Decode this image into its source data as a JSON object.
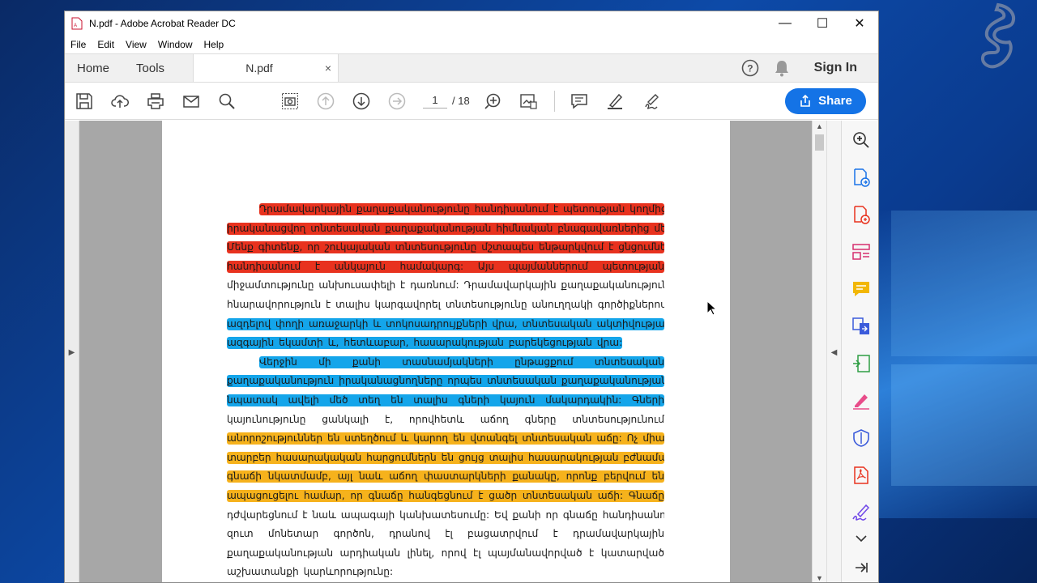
{
  "window": {
    "title": "N.pdf - Adobe Acrobat Reader DC",
    "controls": {
      "minimize": "—",
      "maximize": "☐",
      "close": "✕"
    }
  },
  "menu": [
    "File",
    "Edit",
    "View",
    "Window",
    "Help"
  ],
  "tabs": {
    "home": "Home",
    "tools": "Tools",
    "document": "N.pdf",
    "document_close": "×",
    "sign_in": "Sign In"
  },
  "toolbar": {
    "current_page": "1",
    "total_pages": "/ 18",
    "share_label": "Share",
    "icons": [
      "save-icon",
      "upload-icon",
      "print-icon",
      "email-icon",
      "zoom-search-icon",
      "snapshot-icon",
      "page-up-icon",
      "page-down-icon",
      "next-arrow-icon",
      "zoom-tool-icon",
      "page-thumbnail-icon",
      "comment-icon",
      "highlight-pen-icon",
      "sign-icon"
    ]
  },
  "right_panel_icons": [
    "zoom-in-icon",
    "export-pdf-icon",
    "create-pdf-icon",
    "organize-pages-icon",
    "comment-tool-icon",
    "combine-files-icon",
    "compress-icon",
    "fill-sign-icon",
    "protect-icon",
    "pdf-icon",
    "signature-icon",
    "expand-down-icon",
    "forward-icon"
  ],
  "document": {
    "lines": [
      {
        "text": "Դրամավարկային քաղաքականությունը հանդիսանում է պետության կողմից",
        "hl": "red",
        "indent": true
      },
      {
        "text": "իրականացվող տնտեսական քաղաքականության հիմնական բնագավառներից մեկը:",
        "hl": "red"
      },
      {
        "text": "Մենք գիտենք, որ շուկայական տնտեսությունը մշտապես ենթարկվում է ցնցումների և",
        "hl": "red"
      },
      {
        "text": "հանդիսանում է անկայուն համակարգ: Այս պայմաններում պետության",
        "hl": "red"
      },
      {
        "text": "միջամտությունը անխուսափելի է դառնում: Դրամավարկային քաղաքականությունը",
        "hl": "none"
      },
      {
        "text": "հնարավորություն է տալիս կարգավորել տնտեսությունը անուղղակի գործիքներով՝",
        "hl": "none"
      },
      {
        "text": "ազդելով փողի առաջարկի և տոկոսադրույքների վրա, տնտեսական ակտիվության,",
        "hl": "blue"
      },
      {
        "text": "ազգային եկամտի և, հետևաբար, հասարակության բարեկեցության վրա:",
        "hl": "blue",
        "last": true
      },
      {
        "text": "Վերջին մի քանի տասնամյակների ընթացքում տնտեսական",
        "hl": "blue",
        "indent": true
      },
      {
        "text": "քաղաքականություն իրականացնողները որպես տնտեսական քաղաքականության",
        "hl": "blue"
      },
      {
        "text": "նպատակ ավելի մեծ տեղ են տալիս գների կայուն մակարդակին: Գների",
        "hl": "blue"
      },
      {
        "text": "կայունությունը ցանկալի է, որովհետև աճող գները տնտեսությունում",
        "hl": "none"
      },
      {
        "text": "անորոշություններ են ստեղծում և կարող են վտանգել տնտեսական աճը: Ոչ միայն",
        "hl": "orange"
      },
      {
        "text": "տարբեր հասարակական հարցումներն են ցույց տալիս հասարակության բժնամանքը",
        "hl": "orange"
      },
      {
        "text": "գնաճի նկատմամբ, այլ նաև աճող փաստարկների քանակը, որոնք բերվում են",
        "hl": "orange"
      },
      {
        "text": "ապացուցելու համար, որ գնաճը հանգեցնում է ցածր տնտեսական աճի: Գնաճը",
        "hl": "orange"
      },
      {
        "text": "դժվարեցնում է նաև ապագայի կանխատեսումը: Եվ քանի որ գնաճը հանդիսանում է",
        "hl": "none"
      },
      {
        "text": "զուտ մոնետար գործոն, դրանով էլ բացատրվում է դրամավարկային",
        "hl": "none"
      },
      {
        "text": "քաղաքականության արդիական լինել, որով էլ պայմանավորված է կատարված",
        "hl": "none"
      },
      {
        "text": "աշխատանքի կարևորությունը:",
        "hl": "none",
        "last": true
      }
    ]
  },
  "colors": {
    "red": "#e8321e",
    "blue": "#14a5ea",
    "orange": "#f6b21c",
    "share": "#1473e6"
  }
}
